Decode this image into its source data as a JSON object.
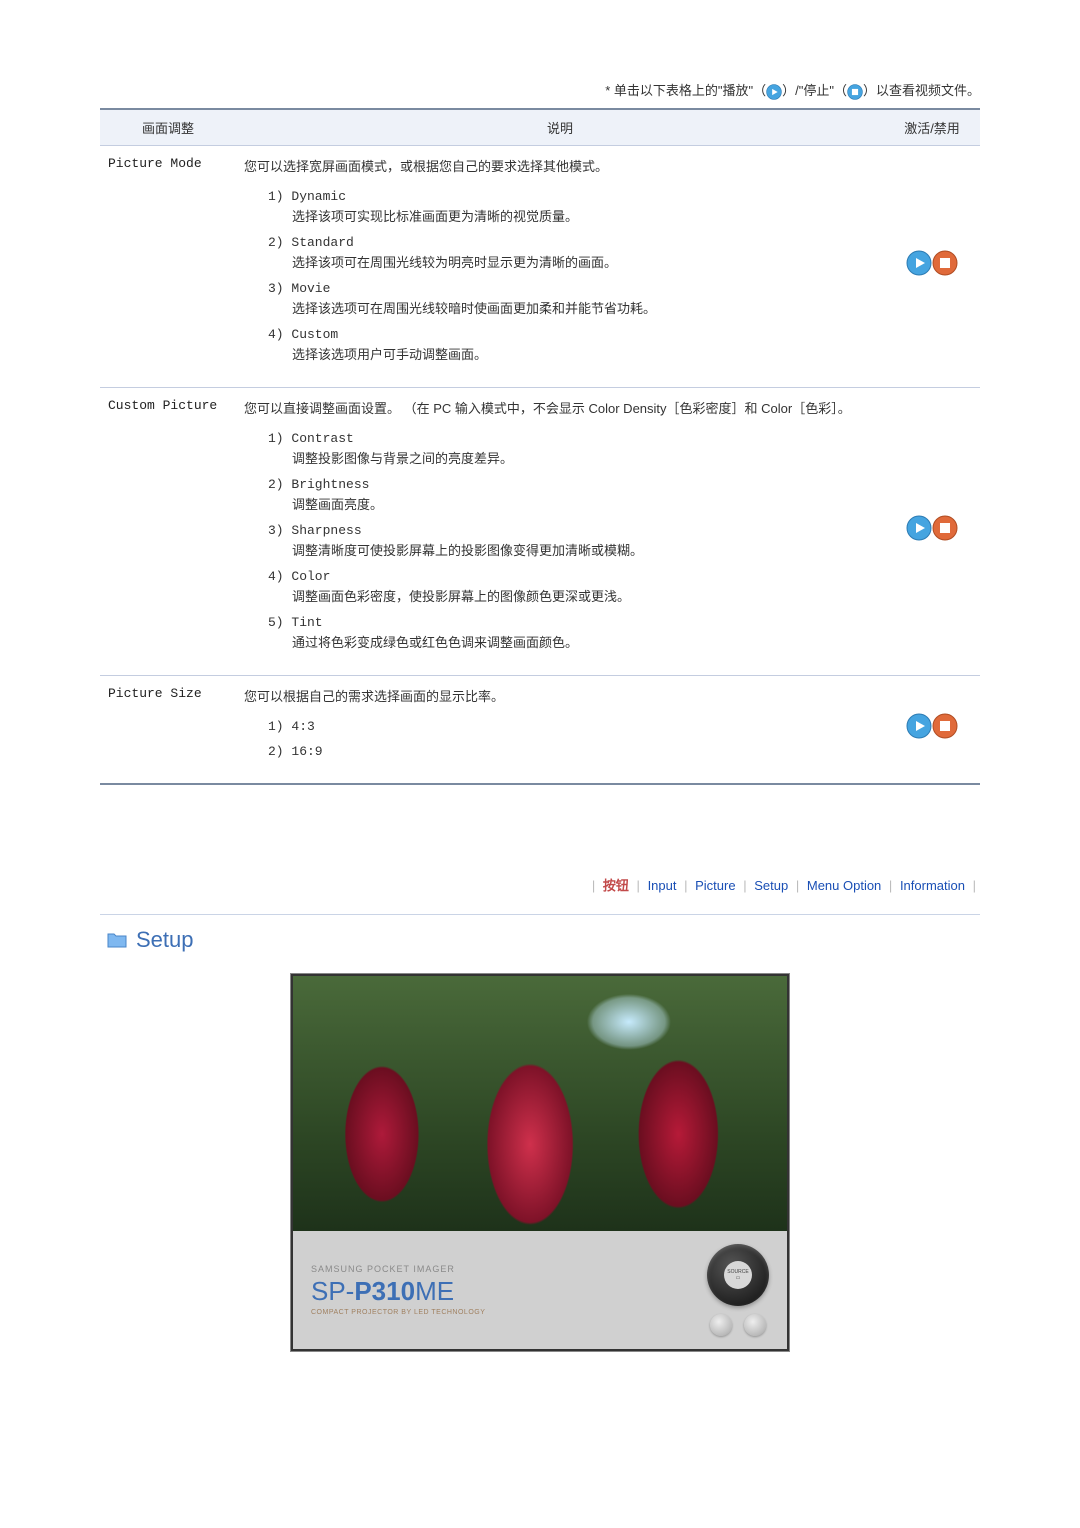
{
  "note": {
    "prefix": "* 单击以下表格上的\"播放\"（",
    "mid": "）/\"停止\"（",
    "suffix": "）以查看视频文件。"
  },
  "table": {
    "headers": {
      "col1": "画面调整",
      "col2": "说明",
      "col3": "激活/禁用"
    }
  },
  "rows": [
    {
      "name": "Picture Mode",
      "intro": "您可以选择宽屏画面模式，或根据您自己的要求选择其他模式。",
      "opts": [
        {
          "title": "1) Dynamic",
          "desc": "选择该项可实现比标准画面更为清晰的视觉质量。"
        },
        {
          "title": "2) Standard",
          "desc": "选择该项可在周围光线较为明亮时显示更为清晰的画面。"
        },
        {
          "title": "3) Movie",
          "desc": "选择该选项可在周围光线较暗时使画面更加柔和并能节省功耗。"
        },
        {
          "title": "4) Custom",
          "desc": "选择该选项用户可手动调整画面。"
        }
      ]
    },
    {
      "name": "Custom Picture",
      "intro": "您可以直接调整画面设置。 （在 PC 输入模式中，不会显示 Color Density［色彩密度］和 Color［色彩］。",
      "opts": [
        {
          "title": "1) Contrast",
          "desc": "调整投影图像与背景之间的亮度差异。"
        },
        {
          "title": "2) Brightness",
          "desc": "调整画面亮度。"
        },
        {
          "title": "3) Sharpness",
          "desc": "调整清晰度可使投影屏幕上的投影图像变得更加清晰或模糊。"
        },
        {
          "title": "4) Color",
          "desc": "调整画面色彩密度，使投影屏幕上的图像颜色更深或更浅。"
        },
        {
          "title": "5) Tint",
          "desc": "通过将色彩变成绿色或红色色调来调整画面颜色。"
        }
      ]
    },
    {
      "name": "Picture Size",
      "intro": "您可以根据自己的需求选择画面的显示比率。",
      "opts": [
        {
          "title": "1) 4:3",
          "desc": ""
        },
        {
          "title": "2) 16:9",
          "desc": ""
        }
      ]
    }
  ],
  "nav": {
    "first": "按钮",
    "items": [
      "Input",
      "Picture",
      "Setup",
      "Menu Option",
      "Information"
    ]
  },
  "section": {
    "title": "Setup"
  },
  "projector": {
    "brand": "SAMSUNG POCKET IMAGER",
    "model_prefix": "SP-",
    "model_main": "P310",
    "model_suffix": "ME",
    "tagline": "COMPACT PROJECTOR BY LED TECHNOLOGY",
    "center_label": "SOURCE"
  },
  "icons": {
    "play": "play-icon",
    "stop": "stop-icon"
  }
}
